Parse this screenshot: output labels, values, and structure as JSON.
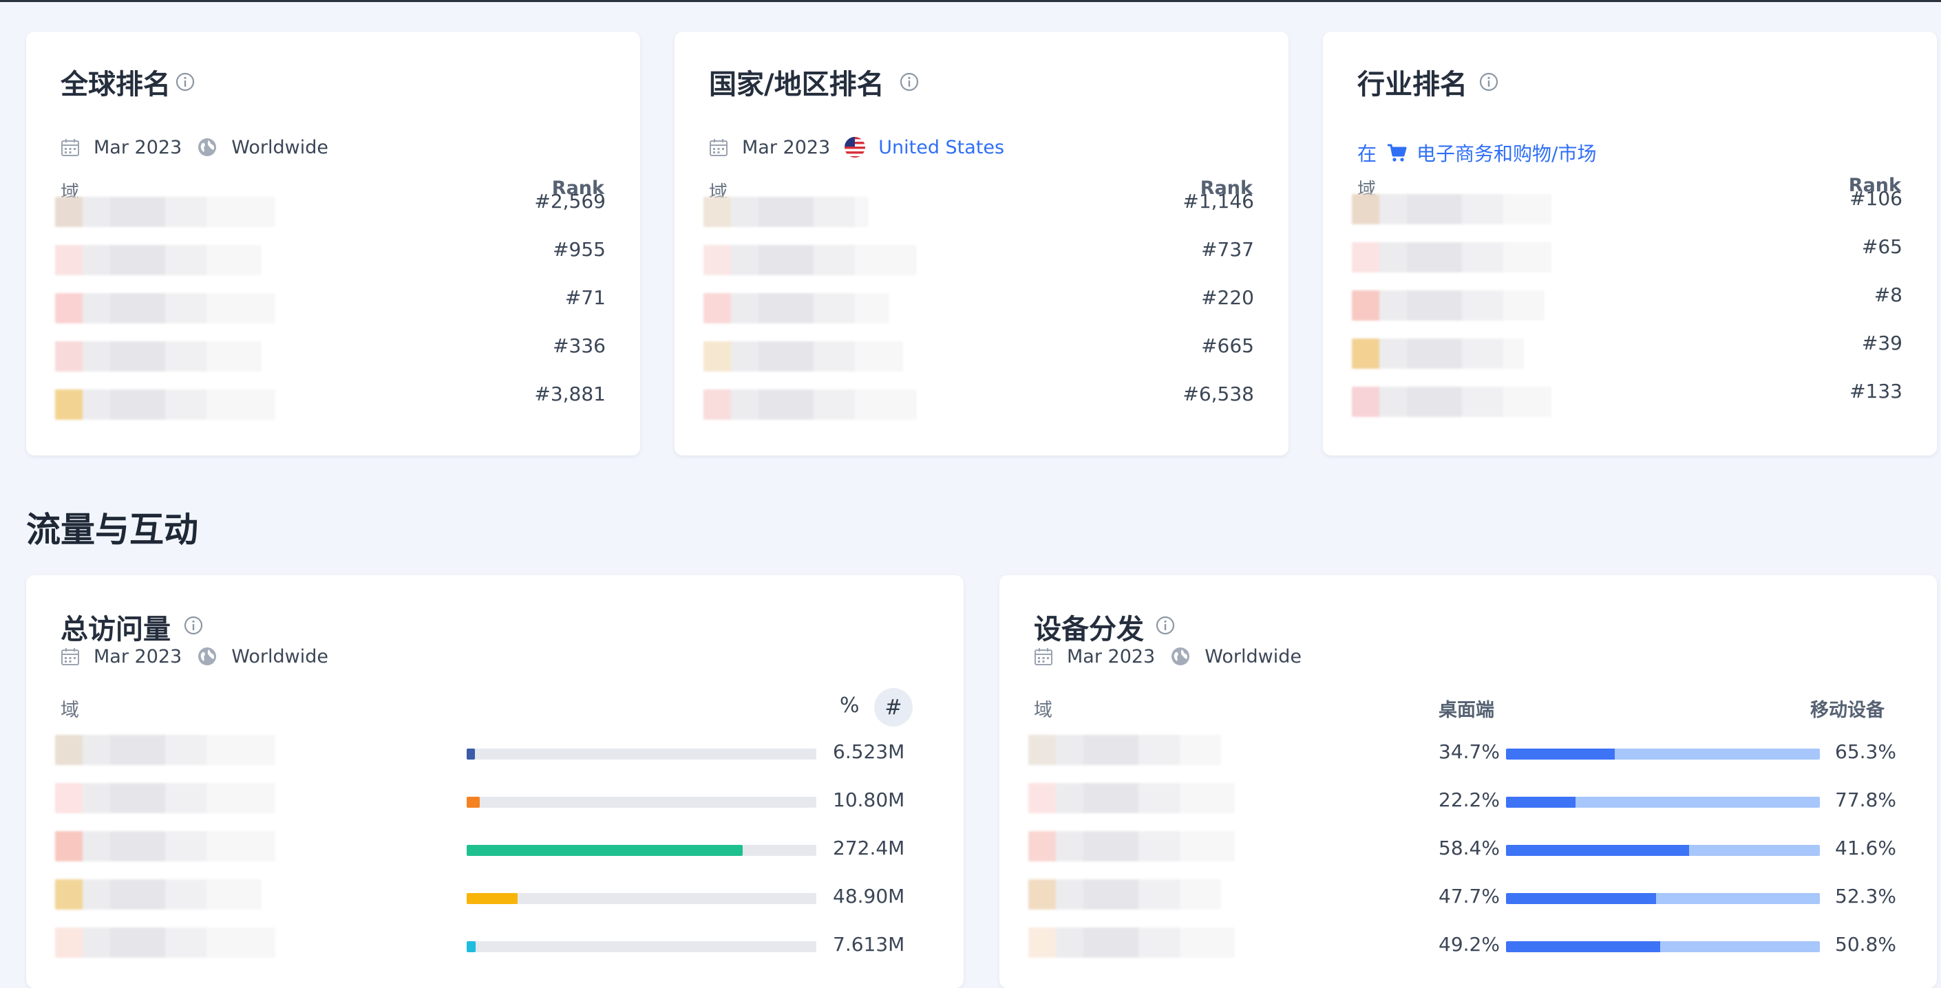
{
  "global_rank": {
    "title": "全球排名",
    "date": "Mar 2023",
    "region": "Worldwide",
    "col_domain": "域",
    "col_rank": "Rank",
    "ranks": [
      "#2,569",
      "#955",
      "#71",
      "#336",
      "#3,881"
    ]
  },
  "country_rank": {
    "title": "国家/地区排名",
    "date": "Mar 2023",
    "region": "United States",
    "col_domain": "域",
    "col_rank": "Rank",
    "ranks": [
      "#1,146",
      "#737",
      "#220",
      "#665",
      "#6,538"
    ]
  },
  "industry_rank": {
    "title": "行业排名",
    "prefix": "在",
    "category": "电子商务和购物/市场",
    "col_domain": "域",
    "col_rank": "Rank",
    "ranks": [
      "#106",
      "#65",
      "#8",
      "#39",
      "#133"
    ]
  },
  "section": {
    "title": "流量与互动"
  },
  "total_visits": {
    "title": "总访问量",
    "date": "Mar 2023",
    "region": "Worldwide",
    "col_domain": "域",
    "toggle_percent": "%",
    "toggle_number": "#",
    "rows": [
      {
        "value": "6.523M",
        "fraction": 0.023,
        "color": "#3b5aa8"
      },
      {
        "value": "10.80M",
        "fraction": 0.037,
        "color": "#f58220"
      },
      {
        "value": "272.4M",
        "fraction": 0.79,
        "color": "#1fc08f"
      },
      {
        "value": "48.90M",
        "fraction": 0.146,
        "color": "#f9b40a"
      },
      {
        "value": "7.613M",
        "fraction": 0.026,
        "color": "#1ebde0"
      }
    ]
  },
  "device": {
    "title": "设备分发",
    "date": "Mar 2023",
    "region": "Worldwide",
    "col_domain": "域",
    "col_desktop": "桌面端",
    "col_mobile": "移动设备",
    "color_desktop": "#3d73f5",
    "color_mobile": "#a7c6fb",
    "rows": [
      {
        "desktop": "34.7%",
        "mobile": "65.3%",
        "desktop_fraction": 0.347
      },
      {
        "desktop": "22.2%",
        "mobile": "77.8%",
        "desktop_fraction": 0.222
      },
      {
        "desktop": "58.4%",
        "mobile": "41.6%",
        "desktop_fraction": 0.584
      },
      {
        "desktop": "47.7%",
        "mobile": "52.3%",
        "desktop_fraction": 0.477
      },
      {
        "desktop": "49.2%",
        "mobile": "50.8%",
        "desktop_fraction": 0.492
      }
    ]
  }
}
